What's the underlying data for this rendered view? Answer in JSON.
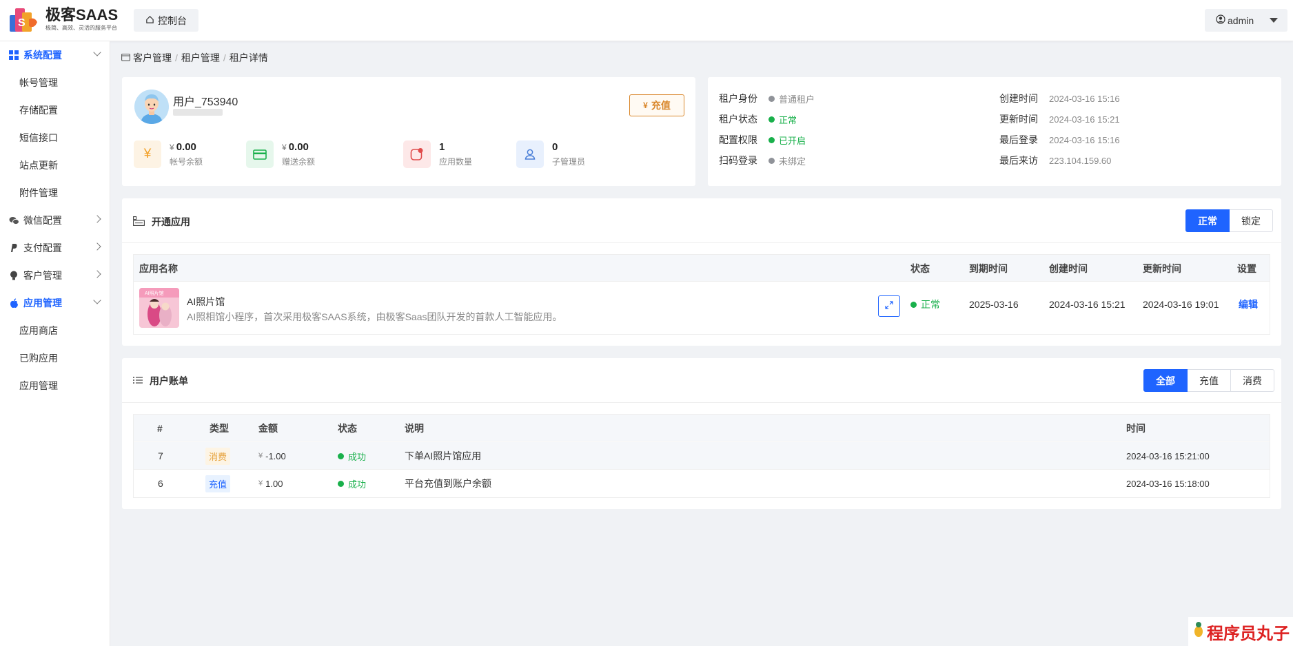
{
  "header": {
    "brand_title": "极客SAAS",
    "brand_subtitle": "极简、高效、灵活的服务平台",
    "console_label": "控制台",
    "user_label": "admin"
  },
  "sidebar": {
    "groups": [
      {
        "label": "系统配置",
        "icon": "grid-icon",
        "expanded": true,
        "active": true,
        "items": [
          "帐号管理",
          "存储配置",
          "短信接口",
          "站点更新",
          "附件管理"
        ]
      },
      {
        "label": "微信配置",
        "icon": "wechat-icon",
        "expanded": false
      },
      {
        "label": "支付配置",
        "icon": "paypal-icon",
        "expanded": false
      },
      {
        "label": "客户管理",
        "icon": "bulb-icon",
        "expanded": false
      },
      {
        "label": "应用管理",
        "icon": "apple-icon",
        "expanded": true,
        "active": true,
        "items": [
          "应用商店",
          "已购应用",
          "应用管理"
        ]
      }
    ]
  },
  "breadcrumb": [
    "客户管理",
    "租户管理",
    "租户详情"
  ],
  "profile": {
    "name": "用户_753940",
    "recharge_label": "充值",
    "currency": "¥",
    "stats": [
      {
        "value": "0.00",
        "label": "帐号余额",
        "currency": true,
        "icon": "yen-icon",
        "color": "#f2a22a",
        "bg": "#fdf3e4"
      },
      {
        "value": "0.00",
        "label": "赠送余额",
        "currency": true,
        "icon": "card-icon",
        "color": "#19b04b",
        "bg": "#e6f7ec"
      },
      {
        "value": "1",
        "label": "应用数量",
        "currency": false,
        "icon": "app-icon",
        "color": "#e04a4a",
        "bg": "#fde8e8"
      },
      {
        "value": "0",
        "label": "子管理员",
        "currency": false,
        "icon": "user-icon",
        "color": "#4a7fd8",
        "bg": "#e8f0fd"
      }
    ]
  },
  "tenant_info": {
    "left": [
      {
        "key": "租户身份",
        "value": "普通租户",
        "status": "gray"
      },
      {
        "key": "租户状态",
        "value": "正常",
        "status": "green"
      },
      {
        "key": "配置权限",
        "value": "已开启",
        "status": "green"
      },
      {
        "key": "扫码登录",
        "value": "未绑定",
        "status": "gray"
      }
    ],
    "right": [
      {
        "key": "创建时间",
        "value": "2024-03-16 15:16"
      },
      {
        "key": "更新时间",
        "value": "2024-03-16 15:21"
      },
      {
        "key": "最后登录",
        "value": "2024-03-16 15:16"
      },
      {
        "key": "最后来访",
        "value": "223.104.159.60"
      }
    ]
  },
  "apps": {
    "title": "开通应用",
    "filters": [
      {
        "label": "正常",
        "active": true
      },
      {
        "label": "锁定",
        "active": false
      }
    ],
    "columns": [
      "应用名称",
      "状态",
      "到期时间",
      "创建时间",
      "更新时间",
      "设置"
    ],
    "rows": [
      {
        "thumb_text": "AI照片馆",
        "name": "AI照片馆",
        "desc": "AI照相馆小程序，首次采用极客SAAS系统，由极客Saas团队开发的首款人工智能应用。",
        "status": "正常",
        "expire": "2025-03-16",
        "created": "2024-03-16 15:21",
        "updated": "2024-03-16 19:01",
        "action": "编辑"
      }
    ]
  },
  "bills": {
    "title": "用户账单",
    "filters": [
      {
        "label": "全部",
        "active": true
      },
      {
        "label": "充值",
        "active": false
      },
      {
        "label": "消费",
        "active": false
      }
    ],
    "columns": [
      "#",
      "类型",
      "金额",
      "状态",
      "说明",
      "时间"
    ],
    "rows": [
      {
        "id": "7",
        "type": "消费",
        "type_color": "orange",
        "amount": "-1.00",
        "status": "成功",
        "desc": "下单AI照片馆应用",
        "time": "2024-03-16 15:21:00"
      },
      {
        "id": "6",
        "type": "充值",
        "type_color": "blue",
        "amount": "1.00",
        "status": "成功",
        "desc": "平台充值到账户余额",
        "time": "2024-03-16 15:18:00"
      }
    ]
  },
  "watermark": "程序员丸子",
  "colors": {
    "primary": "#1f64ff",
    "success": "#19b04b",
    "warning": "#d9862a"
  }
}
